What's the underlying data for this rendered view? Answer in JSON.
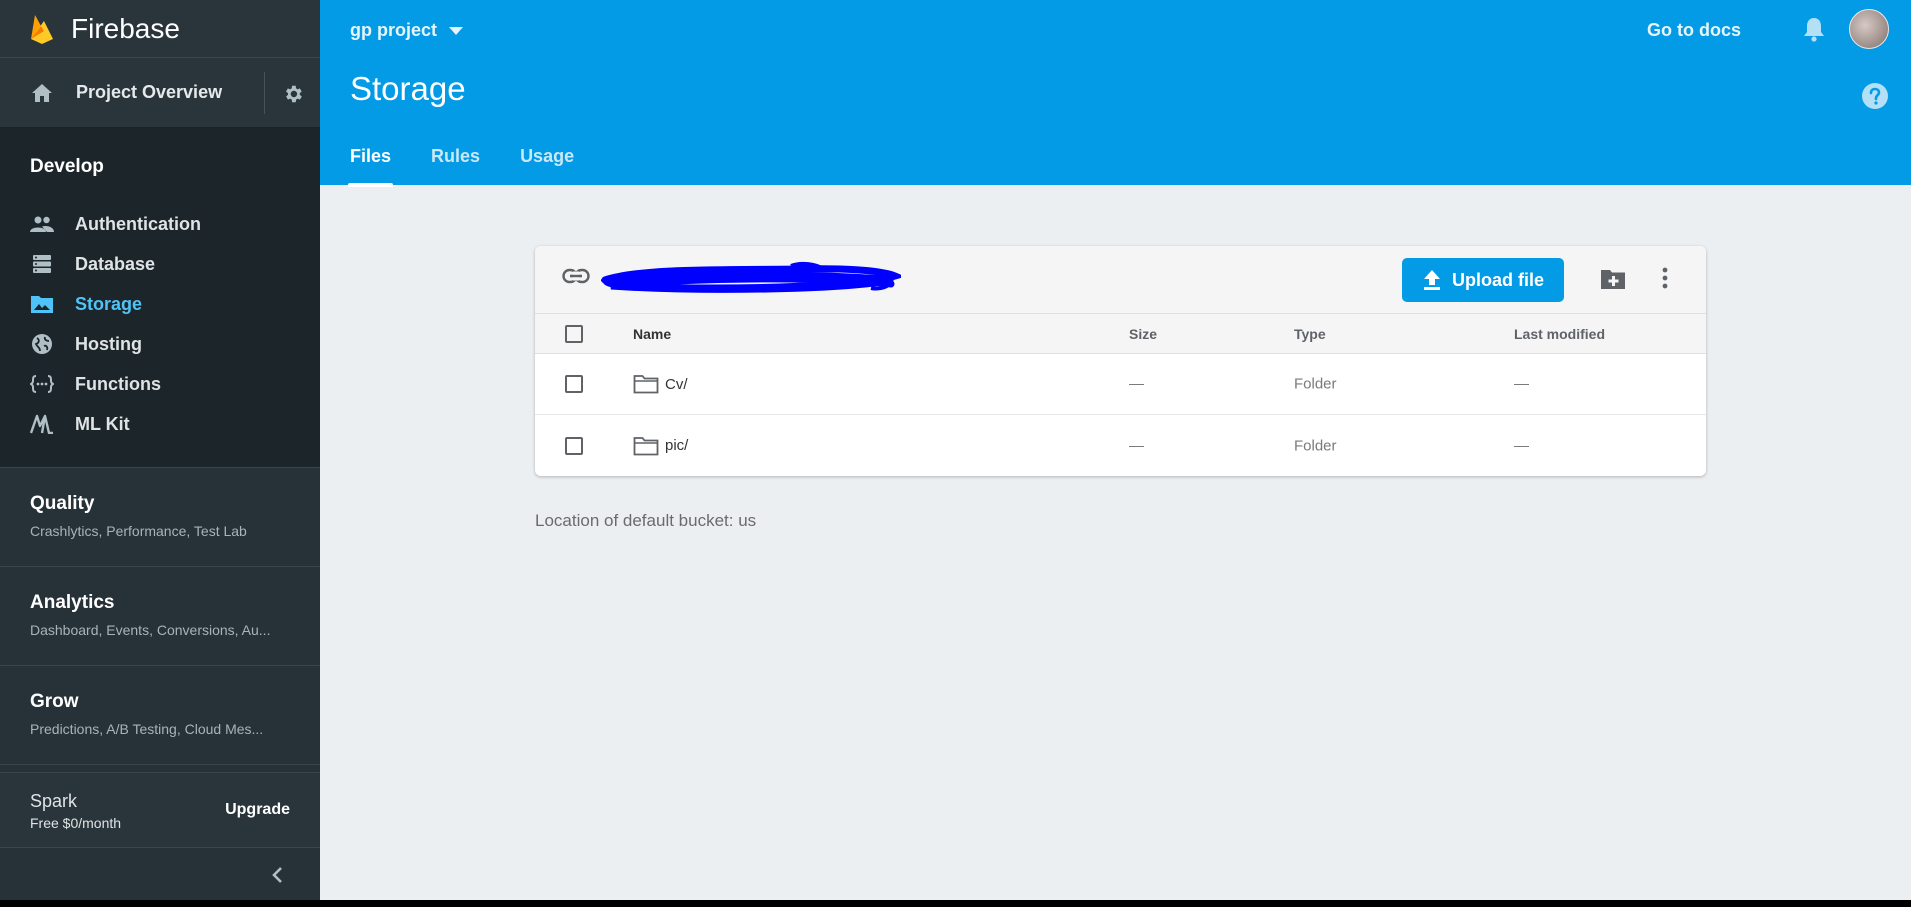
{
  "sidebar": {
    "brand": "Firebase",
    "overview_label": "Project Overview",
    "develop_title": "Develop",
    "develop_items": [
      {
        "label": "Authentication",
        "icon": "people-icon"
      },
      {
        "label": "Database",
        "icon": "database-icon"
      },
      {
        "label": "Storage",
        "icon": "storage-icon",
        "active": true
      },
      {
        "label": "Hosting",
        "icon": "globe-icon"
      },
      {
        "label": "Functions",
        "icon": "functions-icon"
      },
      {
        "label": "ML Kit",
        "icon": "mlkit-icon"
      }
    ],
    "groups": [
      {
        "title": "Quality",
        "subtitle": "Crashlytics, Performance, Test Lab"
      },
      {
        "title": "Analytics",
        "subtitle": "Dashboard, Events, Conversions, Au..."
      },
      {
        "title": "Grow",
        "subtitle": "Predictions, A/B Testing, Cloud Mes..."
      }
    ],
    "plan": {
      "name": "Spark",
      "price": "Free $0/month",
      "upgrade_label": "Upgrade"
    }
  },
  "header": {
    "project": "gp project",
    "docs_label": "Go to docs",
    "page_title": "Storage",
    "tabs": [
      {
        "label": "Files",
        "active": true
      },
      {
        "label": "Rules"
      },
      {
        "label": "Usage"
      }
    ]
  },
  "card": {
    "upload_label": "Upload file",
    "columns": {
      "name": "Name",
      "size": "Size",
      "type": "Type",
      "modified": "Last modified"
    },
    "rows": [
      {
        "name": "Cv/",
        "size": "—",
        "type": "Folder",
        "modified": "—"
      },
      {
        "name": "pic/",
        "size": "—",
        "type": "Folder",
        "modified": "—"
      }
    ]
  },
  "location_text": "Location of default bucket: us",
  "colors": {
    "accent": "#039be5",
    "sidebar": "#263238",
    "active_nav": "#4fc3f7",
    "redaction": "#0000ff"
  }
}
